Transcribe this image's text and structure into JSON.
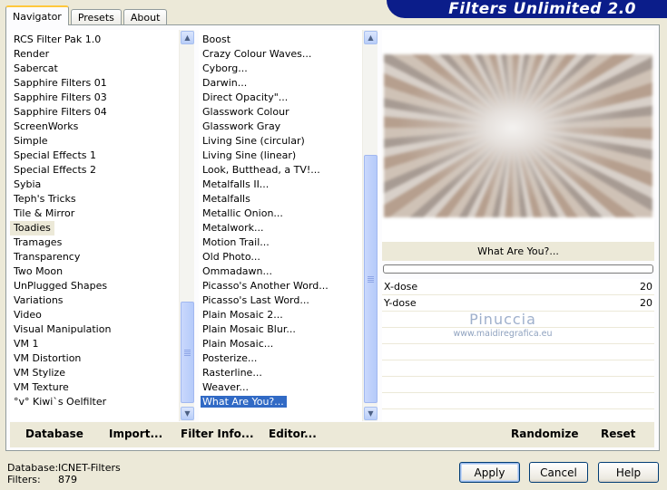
{
  "tabs": [
    {
      "label": "Navigator",
      "active": true
    },
    {
      "label": "Presets",
      "active": false
    },
    {
      "label": "About",
      "active": false
    }
  ],
  "banner": {
    "title": "Filters Unlimited 2.0"
  },
  "categories": {
    "items": [
      "RCS Filter Pak 1.0",
      "Render",
      "Sabercat",
      "Sapphire Filters 01",
      "Sapphire Filters 03",
      "Sapphire Filters 04",
      "ScreenWorks",
      "Simple",
      "Special Effects 1",
      "Special Effects 2",
      "Sybia",
      "Teph's Tricks",
      "Tile & Mirror",
      "Toadies",
      "Tramages",
      "Transparency",
      "Two Moon",
      "UnPlugged Shapes",
      "Variations",
      "Video",
      "Visual Manipulation",
      "VM 1",
      "VM Distortion",
      "VM Stylize",
      "VM Texture",
      "°v° Kiwi`s Oelfilter"
    ],
    "selected": "Toadies"
  },
  "filters": {
    "items": [
      "Boost",
      "Crazy Colour Waves...",
      "Cyborg...",
      "Darwin...",
      "Direct Opacity\"...",
      "Glasswork Colour",
      "Glasswork Gray",
      "Living Sine (circular)",
      "Living Sine (linear)",
      "Look, Butthead, a TV!...",
      "Metalfalls II...",
      "Metalfalls",
      "Metallic Onion...",
      "Metalwork...",
      "Motion Trail...",
      "Old Photo...",
      "Ommadawn...",
      "Picasso's Another Word...",
      "Picasso's Last Word...",
      "Plain Mosaic 2...",
      "Plain Mosaic Blur...",
      "Plain Mosaic...",
      "Posterize...",
      "Rasterline...",
      "Weaver...",
      "What Are You?..."
    ],
    "selected": "What Are You?..."
  },
  "preview": {
    "filter_title": "What Are You?..."
  },
  "params": [
    {
      "label": "X-dose",
      "value": "20"
    },
    {
      "label": "Y-dose",
      "value": "20"
    }
  ],
  "watermark": {
    "name": "Pinuccia",
    "url": "www.maidiregrafica.eu"
  },
  "panel_buttons": {
    "database": "Database",
    "import": "Import...",
    "filter_info": "Filter Info...",
    "editor": "Editor...",
    "randomize": "Randomize",
    "reset": "Reset"
  },
  "footer": {
    "database_label": "Database:",
    "database_value": "ICNET-Filters",
    "filters_label": "Filters:",
    "filters_value": "879",
    "apply": "Apply",
    "cancel": "Cancel",
    "help": "Help"
  }
}
